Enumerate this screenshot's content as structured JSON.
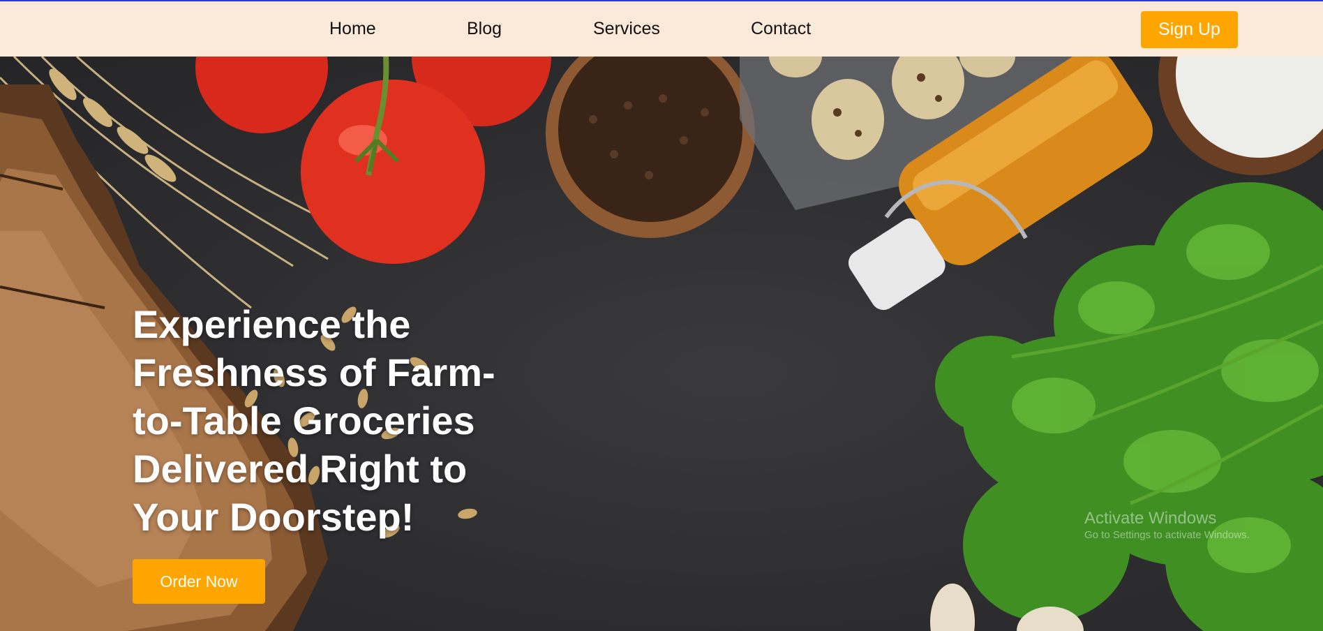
{
  "nav": {
    "links": [
      "Home",
      "Blog",
      "Services",
      "Contact"
    ],
    "signup_label": "Sign Up"
  },
  "hero": {
    "headline_lines": [
      "Experience the",
      "Freshness of Farm-",
      "to-Table Groceries",
      "Delivered Right to",
      "Your Doorstep!"
    ],
    "cta_label": "Order Now"
  },
  "watermark": {
    "title": "Activate Windows",
    "subtitle": "Go to Settings to activate Windows."
  },
  "colors": {
    "nav_background": "#fbe9da",
    "accent": "#ffa500",
    "top_border": "#2f3bd6",
    "hero_background": "#2f2f31"
  }
}
